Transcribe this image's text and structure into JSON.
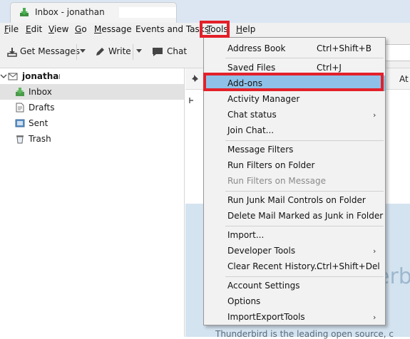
{
  "window": {
    "tab_title": "Inbox - jonathan"
  },
  "menubar": {
    "items": [
      {
        "label": "File",
        "ul": "F",
        "rest": "ile"
      },
      {
        "label": "Edit",
        "ul": "E",
        "rest": "dit"
      },
      {
        "label": "View",
        "ul": "V",
        "rest": "iew"
      },
      {
        "label": "Go",
        "ul": "G",
        "rest": "o"
      },
      {
        "label": "Message",
        "ul": "M",
        "rest": "essage"
      },
      {
        "label": "Events and Tasks",
        "ul": "",
        "rest": "Events and Tasks"
      },
      {
        "label": "Tools",
        "ul": "T",
        "rest": "ools"
      },
      {
        "label": "Help",
        "ul": "H",
        "rest": "elp"
      }
    ]
  },
  "toolbar": {
    "get_messages": "Get Messages",
    "write": "Write",
    "chat": "Chat"
  },
  "folders": {
    "account": "jonathan",
    "items": [
      "Inbox",
      "Drafts",
      "Sent",
      "Trash"
    ],
    "selected": "Inbox"
  },
  "threadhead": {
    "partial_label": "At"
  },
  "startpage": {
    "brand_fragment": "erb",
    "tagline": "Thunderbird is the leading open source, c"
  },
  "tools_menu": {
    "items": [
      {
        "label": "Address Book",
        "shortcut": "Ctrl+Shift+B"
      },
      {
        "label": "Saved Files",
        "shortcut": "Ctrl+J"
      },
      {
        "label": "Add-ons",
        "shortcut": "",
        "highlighted": true
      },
      {
        "label": "Activity Manager",
        "shortcut": ""
      },
      {
        "label": "Chat status",
        "shortcut": "",
        "submenu": true
      },
      {
        "label": "Join Chat...",
        "shortcut": ""
      },
      {
        "label": "Message Filters",
        "shortcut": ""
      },
      {
        "label": "Run Filters on Folder",
        "shortcut": ""
      },
      {
        "label": "Run Filters on Message",
        "shortcut": "",
        "disabled": true
      },
      {
        "label": "Run Junk Mail Controls on Folder",
        "shortcut": ""
      },
      {
        "label": "Delete Mail Marked as Junk in Folder",
        "shortcut": ""
      },
      {
        "label": "Import...",
        "shortcut": ""
      },
      {
        "label": "Developer Tools",
        "shortcut": "",
        "submenu": true
      },
      {
        "label": "Clear Recent History...",
        "shortcut": "Ctrl+Shift+Del"
      },
      {
        "label": "Account Settings",
        "shortcut": ""
      },
      {
        "label": "Options",
        "shortcut": ""
      },
      {
        "label": "ImportExportTools",
        "shortcut": "",
        "submenu": true
      }
    ]
  },
  "colors": {
    "highlight_border": "#e3202a",
    "menu_hover": "#8fc1e8",
    "accent": "#2a7ac6"
  }
}
